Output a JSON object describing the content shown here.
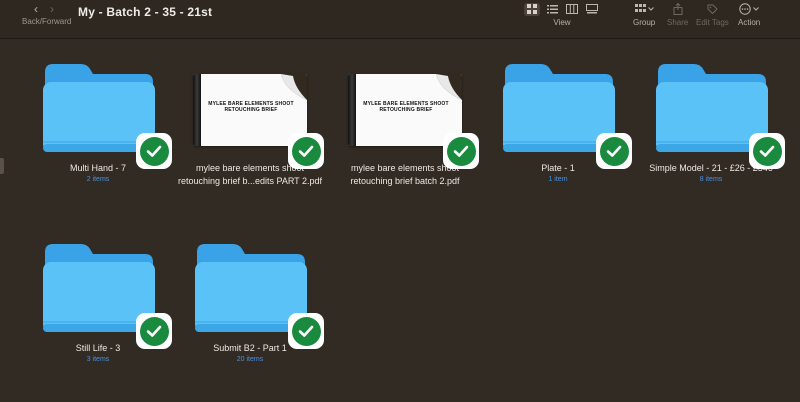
{
  "toolbar": {
    "back_forward_label": "Back/Forward",
    "title": "My - Batch 2 - 35 - 21st",
    "view_label": "View",
    "group_label": "Group",
    "share_label": "Share",
    "edit_tags_label": "Edit Tags",
    "action_label": "Action"
  },
  "items": [
    {
      "name_line1": "Multi Hand - 7",
      "name_line2": "",
      "count": "2 items"
    },
    {
      "name_line1": "mylee bare elements shoot",
      "name_line2": "retouching brief b...edits PART 2.pdf",
      "count": "",
      "doc_text_1": "MYLEE BARE ELEMENTS SHOOT",
      "doc_text_2": "RETOUCHING BRIEF"
    },
    {
      "name_line1": "mylee bare elements shoot",
      "name_line2": "retouching brief batch 2.pdf",
      "count": "",
      "doc_text_1": "MYLEE BARE ELEMENTS SHOOT",
      "doc_text_2": "RETOUCHING BRIEF"
    },
    {
      "name_line1": "Plate - 1",
      "name_line2": "",
      "count": "1 item"
    },
    {
      "name_line1": "Simple Model - 21 - £26 - £546",
      "name_line2": "",
      "count": "8 items"
    },
    {
      "name_line1": "Still Life - 3",
      "name_line2": "",
      "count": "3 items"
    },
    {
      "name_line1": "Submit B2 - Part 1",
      "name_line2": "",
      "count": "20 items"
    }
  ],
  "colors": {
    "background": "#322b23",
    "folder_blue": "#5bc2f7",
    "check_green": "#1a8a3f",
    "count_blue": "#4a90e2"
  }
}
